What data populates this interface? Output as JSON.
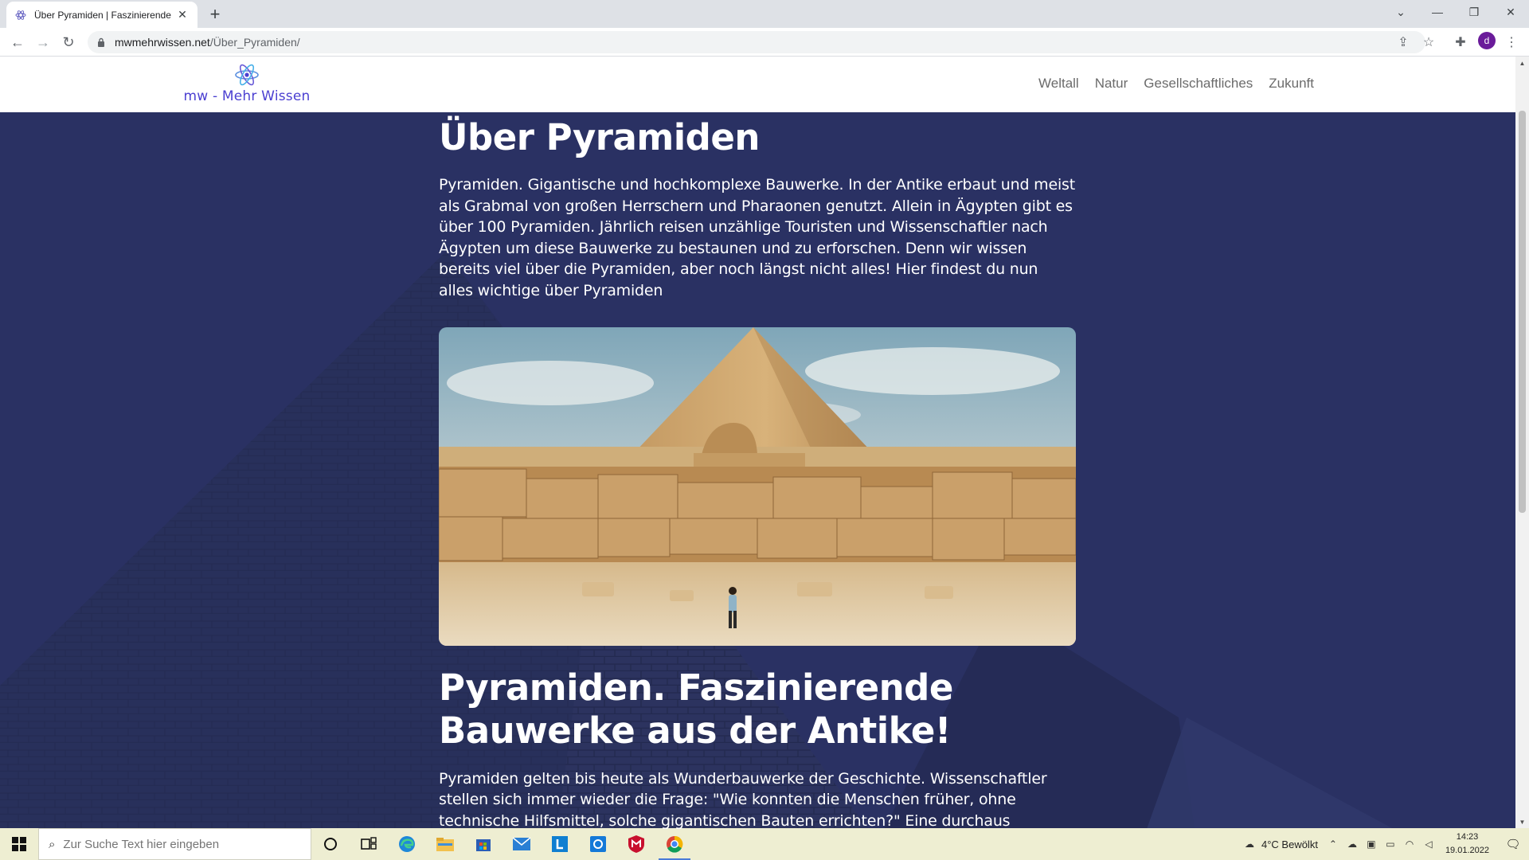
{
  "browser": {
    "tab_title": "Über Pyramiden | Faszinierende B",
    "url_host": "mwmehrwissen.net",
    "url_path": "/Über_Pyramiden/",
    "profile_initial": "d"
  },
  "site": {
    "logo_text": "mw - Mehr Wissen",
    "nav": [
      "Weltall",
      "Natur",
      "Gesellschaftliches",
      "Zukunft"
    ]
  },
  "article": {
    "title": "Über Pyramiden",
    "intro": "Pyramiden. Gigantische und hochkomplexe Bauwerke. In der Antike erbaut und meist als Grabmal von großen Herrschern und Pharaonen genutzt. Allein in Ägypten gibt es über 100 Pyramiden. Jährlich reisen unzählige Touristen und Wissenschaftler nach Ägypten um diese Bauwerke zu bestaunen und zu erforschen. Denn wir wissen bereits viel über die Pyramiden, aber noch längst nicht alles! Hier findest du nun alles wichtige über Pyramiden",
    "heading2": "Pyramiden. Faszinierende Bauwerke aus der Antike!",
    "para2": "Pyramiden gelten bis heute als Wunderbauwerke der Geschichte. Wissenschaftler stellen sich immer wieder die Frage: \"Wie konnten die Menschen früher, ohne technische Hilfsmittel, solche gigantischen Bauten errichten?\" Eine durchaus"
  },
  "taskbar": {
    "search_placeholder": "Zur Suche Text hier eingeben",
    "weather": "4°C  Bewölkt",
    "time": "14:23",
    "date": "19.01.2022"
  },
  "colors": {
    "hero_bg": "#2a3163",
    "logo": "#4b3fd1",
    "taskbar": "#eeeed2"
  }
}
